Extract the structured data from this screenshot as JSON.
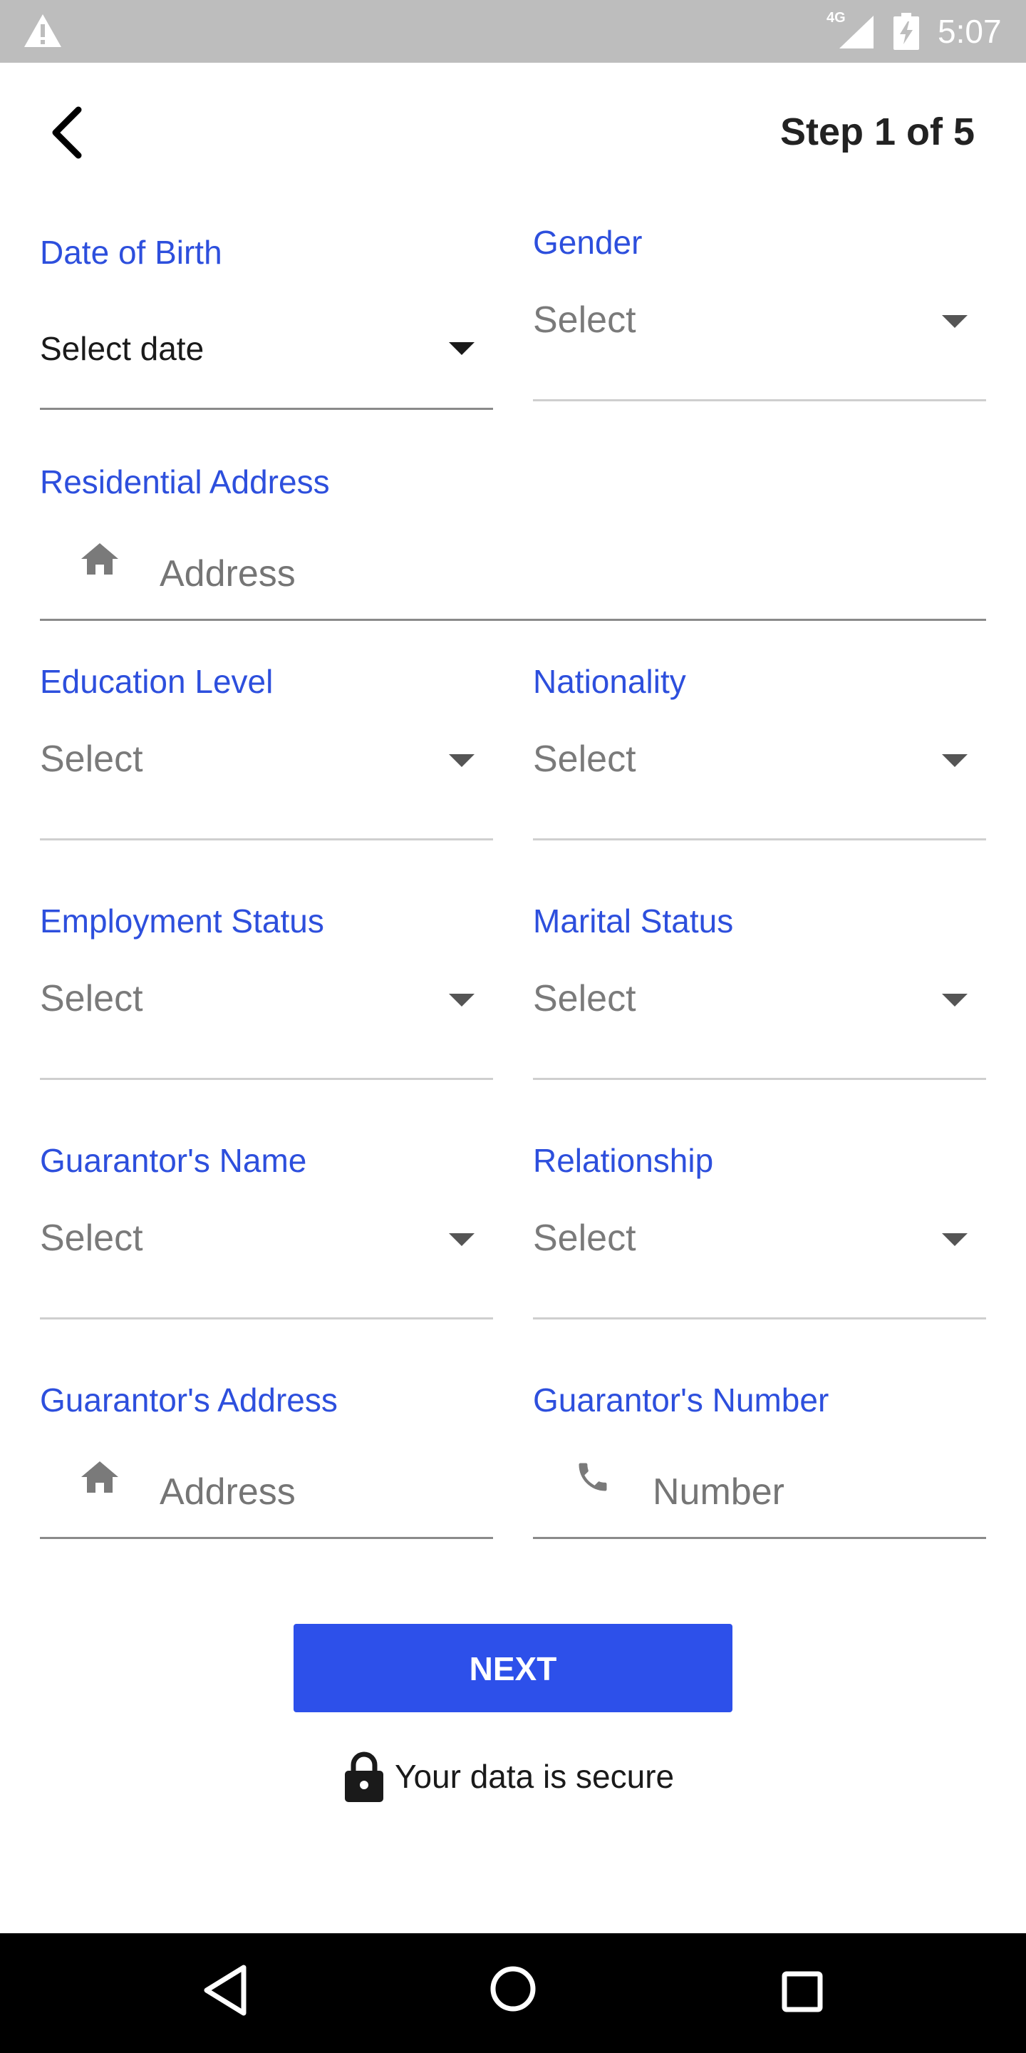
{
  "status_bar": {
    "network": "4G",
    "time": "5:07"
  },
  "header": {
    "step": "Step 1 of 5"
  },
  "form": {
    "dob": {
      "label": "Date of Birth",
      "value": "Select date"
    },
    "gender": {
      "label": "Gender",
      "value": "Select"
    },
    "residential_address": {
      "label": "Residential Address",
      "placeholder": "Address"
    },
    "education": {
      "label": "Education Level",
      "value": "Select"
    },
    "nationality": {
      "label": "Nationality",
      "value": "Select"
    },
    "employment": {
      "label": "Employment Status",
      "value": "Select"
    },
    "marital": {
      "label": "Marital Status",
      "value": "Select"
    },
    "guarantor_name": {
      "label": "Guarantor's Name",
      "value": "Select"
    },
    "relationship": {
      "label": "Relationship",
      "value": "Select"
    },
    "guarantor_address": {
      "label": "Guarantor's Address",
      "placeholder": "Address"
    },
    "guarantor_number": {
      "label": "Guarantor's Number",
      "placeholder": "Number"
    }
  },
  "actions": {
    "next_label": "NEXT",
    "secure_text": "Your data is secure"
  },
  "colors": {
    "accent": "#2d50ea",
    "label": "#2d4fdd",
    "status_bar": "#bdbdbd"
  }
}
